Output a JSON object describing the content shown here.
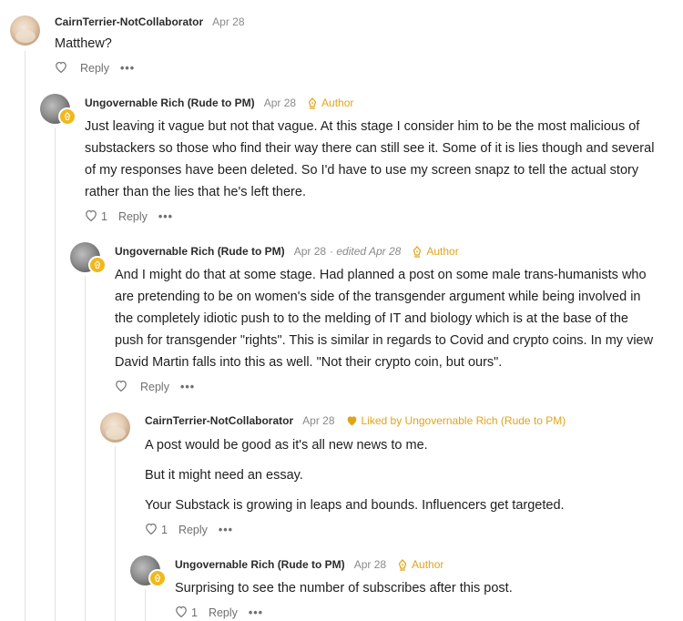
{
  "comments": [
    {
      "author": "CairnTerrier-NotCollaborator",
      "date": "Apr 28",
      "lines": [
        "Matthew?"
      ],
      "like_count": "",
      "reply_label": "Reply"
    },
    {
      "author": "Ungovernable Rich (Rude to PM)",
      "date": "Apr 28",
      "tag": "Author",
      "lines": [
        "Just leaving it vague but not that vague. At this stage I consider him to be the most malicious of",
        "substackers so those who find their way there can still see it. Some of it is lies though and several",
        "of my responses have been deleted. So I'd have to use my screen snapz to tell the actual story",
        "rather than the lies that he's left there."
      ],
      "like_count": "1",
      "reply_label": "Reply"
    },
    {
      "author": "Ungovernable Rich (Rude to PM)",
      "date": "Apr 28",
      "edited": "· edited Apr 28",
      "tag": "Author",
      "lines": [
        "And I might do that at some stage. Had planned a post on some male trans-humanists who",
        "are pretending to be on women's side of the transgender argument while being involved in",
        "the completely idiotic push to to the melding of IT and biology which is at the base of the",
        "push for transgender \"rights\". This is similar in regards to Covid and crypto coins. In my view",
        "David Martin falls into this as well. \"Not their crypto coin, but ours\"."
      ],
      "like_count": "",
      "reply_label": "Reply"
    },
    {
      "author": "CairnTerrier-NotCollaborator",
      "date": "Apr 28",
      "liked_by": "Liked by Ungovernable Rich (Rude to PM)",
      "paragraphs": [
        "A post would be good as it's all new news to me.",
        "But it might need an essay.",
        "Your Substack is growing in leaps and bounds. Influencers get targeted."
      ],
      "like_count": "1",
      "reply_label": "Reply"
    },
    {
      "author": "Ungovernable Rich (Rude to PM)",
      "date": "Apr 28",
      "tag": "Author",
      "lines": [
        "Surprising to see the number of subscribes after this post."
      ],
      "like_count": "1",
      "reply_label": "Reply"
    }
  ]
}
